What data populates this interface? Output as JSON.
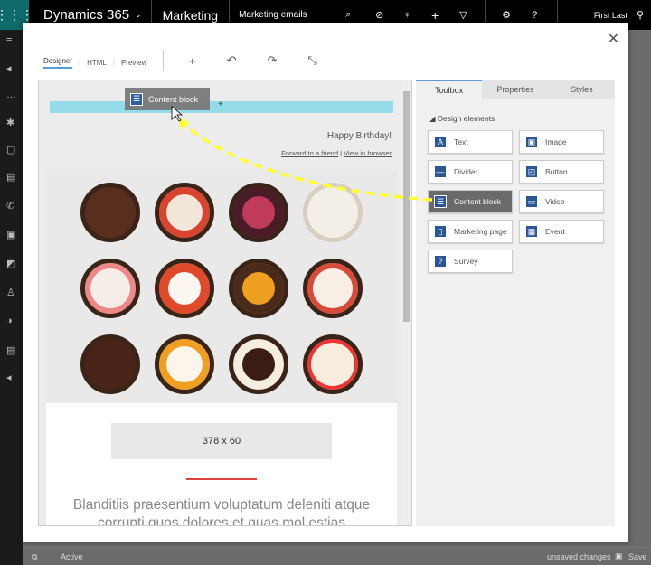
{
  "topbar": {
    "app": "Dynamics 365",
    "module": "Marketing",
    "entity": "Marketing emails",
    "user": "First Last"
  },
  "status": {
    "state": "Active",
    "unsaved": "unsaved changes",
    "save": "Save"
  },
  "dialog": {
    "modes": [
      "Designer",
      "HTML",
      "Preview"
    ],
    "active_mode": "Designer"
  },
  "canvas": {
    "drag_label": "Content block",
    "greeting": "Happy Birthday!",
    "forward": "Forward to a friend",
    "sep": "|",
    "view": "View in browser",
    "placeholder": "378 x 60",
    "body": "Blanditiis praesentium voluptatum deleniti atque corrupti quos dolores et quas mol estias"
  },
  "panel": {
    "tabs": [
      "Toolbox",
      "Properties",
      "Styles"
    ],
    "section": "Design elements",
    "items": [
      {
        "label": "Text",
        "icon": "A"
      },
      {
        "label": "Image",
        "icon": "▣"
      },
      {
        "label": "Divider",
        "icon": "—"
      },
      {
        "label": "Button",
        "icon": "◰"
      },
      {
        "label": "Content block",
        "icon": "☰"
      },
      {
        "label": "Video",
        "icon": "▭"
      },
      {
        "label": "Marketing page",
        "icon": "▯"
      },
      {
        "label": "Event",
        "icon": "▦"
      },
      {
        "label": "Survey",
        "icon": "?"
      }
    ]
  },
  "colors": {
    "accent": "#5b9bd5",
    "drop": "#95dcea",
    "arrow": "#ffff33"
  }
}
